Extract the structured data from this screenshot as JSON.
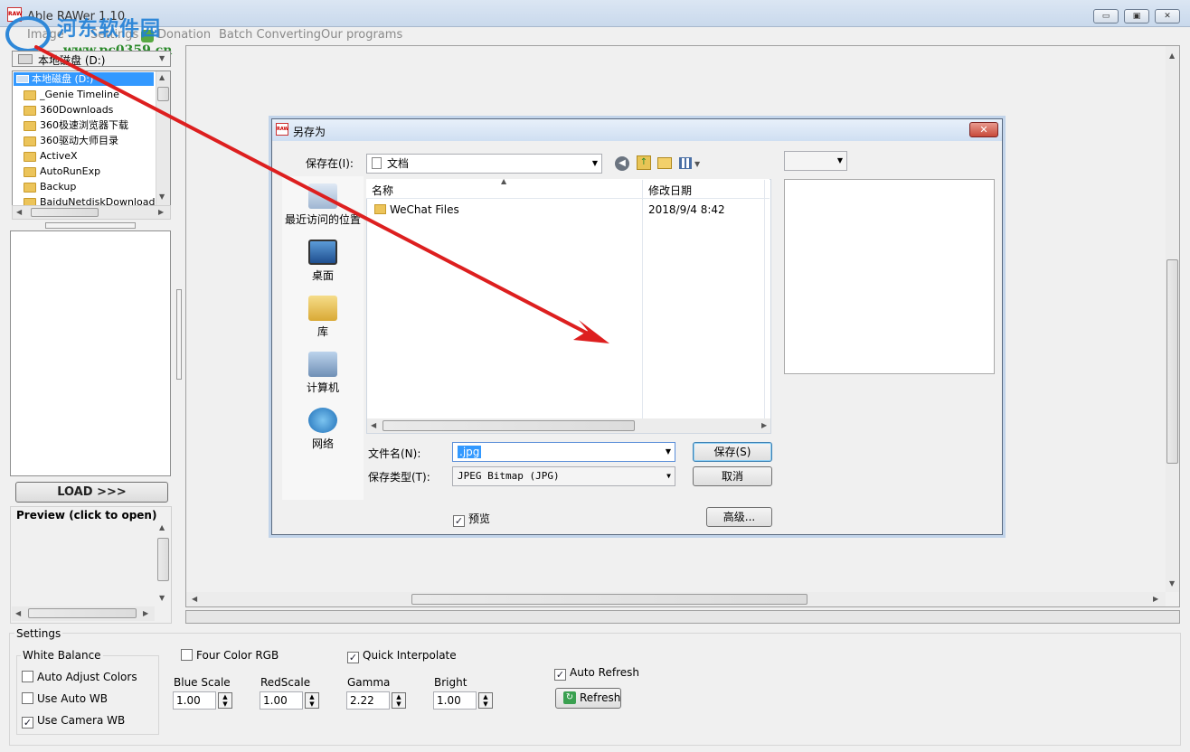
{
  "window": {
    "title": "Able RAWer 1.10",
    "app_icon_text": "RAW",
    "minimize_glyph": "▭",
    "maximize_glyph": "▣",
    "close_glyph": "✕"
  },
  "menu": {
    "items": [
      "Image",
      "Settings",
      "Donation",
      "Batch Converting",
      "Our programs"
    ]
  },
  "watermark": {
    "line1": "河东软件园",
    "line2": "www.pc0359.cn"
  },
  "left_panel": {
    "drive_select": "本地磁盘 (D:)",
    "tree_selected": "本地磁盘 (D:)",
    "folders": [
      "_Genie Timeline",
      "360Downloads",
      "360极速浏览器下载",
      "360驱动大师目录",
      "ActiveX",
      "AutoRunExp",
      "Backup",
      "BaiduNetdiskDownload"
    ],
    "load_button": "LOAD >>>",
    "preview_label": "Preview (click to open)"
  },
  "settings": {
    "group_label": "Settings",
    "white_balance": {
      "label": "White Balance",
      "options": [
        {
          "label": "Auto Adjust Colors",
          "checked": false
        },
        {
          "label": "Use Auto WB",
          "checked": false
        },
        {
          "label": "Use Camera WB",
          "checked": true
        }
      ]
    },
    "four_color_rgb": {
      "label": "Four Color RGB",
      "checked": false
    },
    "quick_interpolate": {
      "label": "Quick Interpolate",
      "checked": true
    },
    "auto_refresh": {
      "label": "Auto Refresh",
      "checked": true
    },
    "fields": [
      {
        "label": "Blue Scale",
        "value": "1.00"
      },
      {
        "label": "RedScale",
        "value": "1.00"
      },
      {
        "label": "Gamma",
        "value": "2.22"
      },
      {
        "label": "Bright",
        "value": "1.00"
      }
    ],
    "refresh_button": "Refresh"
  },
  "dialog": {
    "title": "另存为",
    "icon_text": "RAW",
    "close_glyph": "✕",
    "save_in_label": "保存在(I):",
    "save_in_value": "文档",
    "places": [
      "最近访问的位置",
      "桌面",
      "库",
      "计算机",
      "网络"
    ],
    "columns": [
      "名称",
      "修改日期"
    ],
    "files": [
      {
        "name": "WeChat Files",
        "date": "2018/9/4 8:42"
      }
    ],
    "filename_label": "文件名(N):",
    "filename_value": ".jpg",
    "filetype_label": "保存类型(T):",
    "filetype_value": "JPEG Bitmap (JPG)",
    "save_button": "保存(S)",
    "cancel_button": "取消",
    "preview_checkbox": {
      "label": "预览",
      "checked": true
    },
    "advanced_button": "高级...",
    "check_glyph": "✓"
  },
  "colors": {
    "arrow": "#dd1f1f",
    "selection": "#3399ff",
    "dialog_border": "#5b6b80"
  }
}
